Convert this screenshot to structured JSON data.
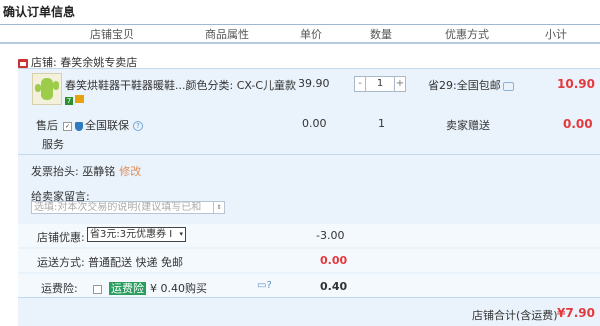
{
  "section_title": "确认订单信息",
  "table_header": {
    "item": "店铺宝贝",
    "attrs": "商品属性",
    "price": "单价",
    "qty": "数量",
    "promo": "优惠方式",
    "subtotal": "小计"
  },
  "shop": {
    "label": "店铺:",
    "name": "春笑余姚专卖店"
  },
  "product": {
    "name": "春笑烘鞋器干鞋器暖鞋...",
    "attr_label": "颜色分类:",
    "attr_value": "CX-C儿童款",
    "badge_num": "7",
    "price": "39.90",
    "qty_minus": "-",
    "qty": "1",
    "qty_plus": "+",
    "promo": "省29:全国包邮",
    "subtotal": "10.90"
  },
  "after_sales": {
    "label_line1": "售后",
    "label_line2": "服务",
    "check_mark": "✓",
    "service": "全国联保",
    "help": "?",
    "price": "0.00",
    "qty": "1",
    "promo": "卖家赠送",
    "subtotal": "0.00"
  },
  "invoice": {
    "label": "发票抬头:",
    "value": "巫静铭",
    "edit": "修改"
  },
  "message": {
    "label": "给卖家留言:",
    "placeholder": "选填:对本次交易的说明(建议填写已和",
    "scroll": "⇕"
  },
  "discount": {
    "label": "店铺优惠:",
    "selected": "省3元:3元优惠券 I",
    "arrow": "▾",
    "value": "-3.00"
  },
  "shipping": {
    "label": "运送方式:",
    "method": "普通配送 快递 免邮",
    "value": "0.00"
  },
  "insurance": {
    "label": "运费险:",
    "name": "运费险",
    "price": "¥ 0.40购买",
    "icons": "▭?",
    "value": "0.40"
  },
  "total": {
    "label": "店铺合计(含运费)",
    "value": "¥7.90"
  }
}
